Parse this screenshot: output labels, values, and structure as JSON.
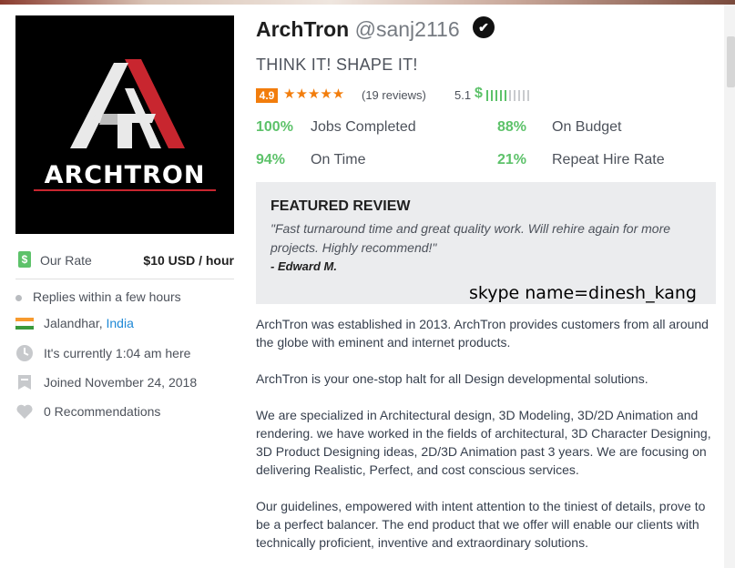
{
  "profile": {
    "logo_text": "ARCHTRON",
    "name": "ArchTron",
    "handle": "@sanj2116",
    "verified_glyph": "✔",
    "tagline": "THINK IT! SHAPE IT!",
    "rating": "4.9",
    "stars": "★★★★★",
    "reviews": "(19 reviews)",
    "earnings_score": "5.1",
    "earnings_symbol": "$",
    "earnings_level_fraction": 0.5
  },
  "stats": [
    {
      "pct": "100%",
      "label": "Jobs Completed"
    },
    {
      "pct": "88%",
      "label": "On Budget"
    },
    {
      "pct": "94%",
      "label": "On Time"
    },
    {
      "pct": "21%",
      "label": "Repeat Hire Rate"
    }
  ],
  "featured_review": {
    "title": "FEATURED REVIEW",
    "quote": "\"Fast turnaround time and great quality work. Will rehire again for more projects. Highly recommend!\"",
    "author": "- Edward M.",
    "overlay_note": "skype name=dinesh_kang"
  },
  "sidebar": {
    "rate_label": "Our Rate",
    "rate_value": "$10 USD / hour",
    "rate_icon": "$",
    "replies": "Replies within a few hours",
    "location_city": "Jalandhar, ",
    "location_country": "India",
    "local_time": "It's currently 1:04 am here",
    "joined": "Joined November 24, 2018",
    "recommendations": "0 Recommendations"
  },
  "about": [
    "ArchTron was established in 2013. ArchTron provides customers from all around the globe with eminent and internet products.",
    "ArchTron is your one-stop halt for all Design developmental solutions.",
    "We are specialized in Architectural design, 3D Modeling, 3D/2D Animation and rendering. we have worked in the fields of architectural, 3D Character Designing, 3D Product Designing ideas, 2D/3D Animation past 3 years. We are focusing on delivering Realistic, Perfect, and cost conscious services.",
    "Our guidelines, empowered with intent attention to the tiniest of details, prove to be a perfect balancer. The end product that we offer will enable our clients with technically proficient, inventive and extraordinary solutions."
  ],
  "colors": {
    "accent_green": "#5dc26a",
    "rating_orange": "#f27d0c",
    "link_blue": "#1e88d6",
    "logo_red": "#c8262f"
  },
  "icons": {
    "rate": "money-tag-icon",
    "replies": "status-dot-icon",
    "location": "india-flag-icon",
    "time": "clock-icon",
    "joined": "calendar-badge-icon",
    "recommendations": "heart-icon",
    "verified": "verified-badge-icon"
  }
}
